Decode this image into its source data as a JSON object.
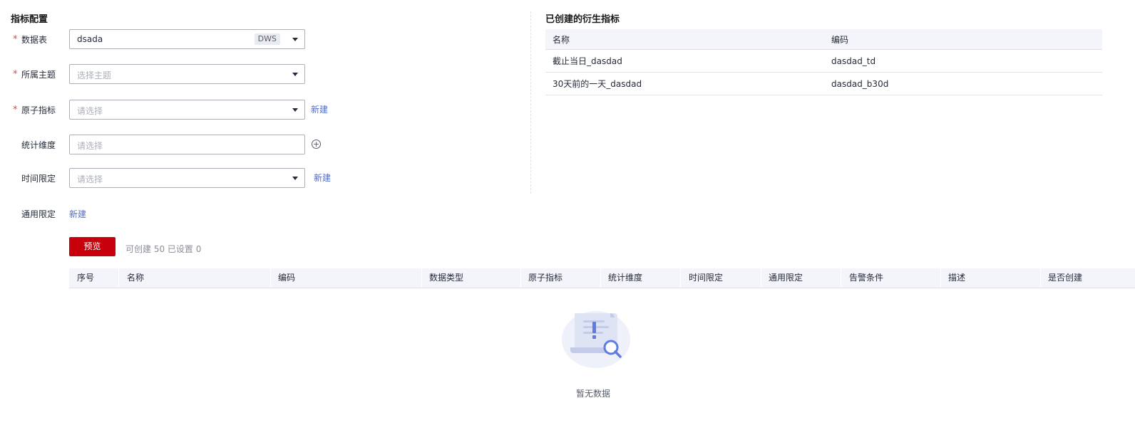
{
  "left_section": {
    "title": "指标配置"
  },
  "right_section": {
    "title": "已创建的衍生指标"
  },
  "form": {
    "table": {
      "label": "数据表",
      "value": "dsada",
      "tag": "DWS"
    },
    "theme": {
      "label": "所属主题",
      "placeholder": "选择主题"
    },
    "atomic": {
      "label": "原子指标",
      "placeholder": "请选择",
      "new_label": "新建"
    },
    "dimension": {
      "label": "统计维度",
      "placeholder": "请选择",
      "add_icon": "plus-circle-icon"
    },
    "time_limit": {
      "label": "时间限定",
      "placeholder": "请选择",
      "new_label": "新建"
    },
    "general_limit": {
      "label": "通用限定",
      "new_label": "新建"
    }
  },
  "created_table": {
    "headers": [
      "名称",
      "编码"
    ],
    "rows": [
      [
        "截止当日_dasdad",
        "dasdad_td"
      ],
      [
        "30天前的一天_dasdad",
        "dasdad_b30d"
      ]
    ]
  },
  "preview": {
    "button_label": "预览",
    "hint": "可创建 50 已设置 0"
  },
  "main_table": {
    "headers": [
      "序号",
      "名称",
      "编码",
      "数据类型",
      "原子指标",
      "统计维度",
      "时间限定",
      "通用限定",
      "告警条件",
      "描述",
      "是否创建"
    ],
    "empty_text": "暂无数据"
  },
  "colors": {
    "primary": "#c7000b",
    "link": "#526ecc",
    "required": "#e54545",
    "header_bg": "#f3f5fb"
  }
}
